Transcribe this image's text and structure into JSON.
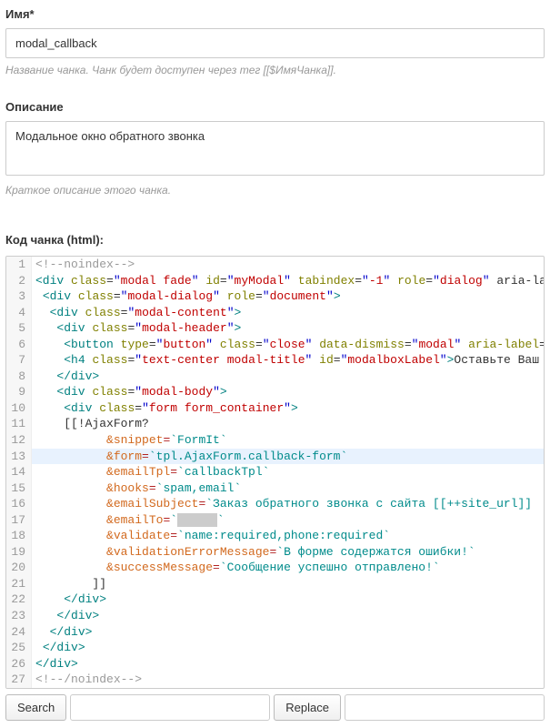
{
  "fields": {
    "name": {
      "label": "Имя*",
      "value": "modal_callback",
      "help": "Название чанка. Чанк будет доступен через тег [[$ИмяЧанка]]."
    },
    "description": {
      "label": "Описание",
      "value": "Модальное окно обратного звонка",
      "help": "Краткое описание этого чанка."
    },
    "code": {
      "label": "Код чанка (html):"
    }
  },
  "toolbar": {
    "search_label": "Search",
    "replace_label": "Replace"
  },
  "code_lines": [
    {
      "n": 1,
      "t": "comment",
      "s": "<!--noindex-->"
    },
    {
      "n": 2,
      "t": "tag",
      "s": "<div class=\"modal fade\" id=\"myModal\" tabindex=\"-1\" role=\"dialog\" aria-la"
    },
    {
      "n": 3,
      "t": "tag",
      "s": " <div class=\"modal-dialog\" role=\"document\">"
    },
    {
      "n": 4,
      "t": "tag",
      "s": "  <div class=\"modal-content\">"
    },
    {
      "n": 5,
      "t": "tag",
      "s": "   <div class=\"modal-header\">"
    },
    {
      "n": 6,
      "t": "tag",
      "s": "    <button type=\"button\" class=\"close\" data-dismiss=\"modal\" aria-label="
    },
    {
      "n": 7,
      "t": "tag",
      "s": "    <h4 class=\"text-center modal-title\" id=\"modalboxLabel\">Оставьте Ваш"
    },
    {
      "n": 8,
      "t": "tag",
      "s": "   </div>"
    },
    {
      "n": 9,
      "t": "tag",
      "s": "   <div class=\"modal-body\">"
    },
    {
      "n": 10,
      "t": "tag",
      "s": "    <div class=\"form form_container\">"
    },
    {
      "n": 11,
      "t": "text",
      "s": "    [[!AjaxForm?"
    },
    {
      "n": 12,
      "t": "kv",
      "k": "&snippet",
      "v": "`FormIt`"
    },
    {
      "n": 13,
      "t": "kv",
      "k": "&form",
      "v": "`tpl.AjaxForm.callback-form`",
      "hl": true
    },
    {
      "n": 14,
      "t": "kv",
      "k": "&emailTpl",
      "v": "`callbackTpl`"
    },
    {
      "n": 15,
      "t": "kv",
      "k": "&hooks",
      "v": "`spam,email`"
    },
    {
      "n": 16,
      "t": "kv",
      "k": "&emailSubject",
      "v": "`Заказ обратного звонка с сайта [[++site_url]]"
    },
    {
      "n": 17,
      "t": "kvredact",
      "k": "&emailTo"
    },
    {
      "n": 18,
      "t": "kv",
      "k": "&validate",
      "v": "`name:required,phone:required`"
    },
    {
      "n": 19,
      "t": "kv",
      "k": "&validationErrorMessage",
      "v": "`В форме содержатся ошибки!`"
    },
    {
      "n": 20,
      "t": "kv",
      "k": "&successMessage",
      "v": "`Сообщение успешно отправлено!`"
    },
    {
      "n": 21,
      "t": "text",
      "s": "        ]]"
    },
    {
      "n": 22,
      "t": "tag",
      "s": "    </div>"
    },
    {
      "n": 23,
      "t": "tag",
      "s": "   </div>"
    },
    {
      "n": 24,
      "t": "tag",
      "s": "  </div>"
    },
    {
      "n": 25,
      "t": "tag",
      "s": " </div>"
    },
    {
      "n": 26,
      "t": "tag",
      "s": "</div>"
    },
    {
      "n": 27,
      "t": "comment",
      "s": "<!--/noindex-->"
    }
  ]
}
